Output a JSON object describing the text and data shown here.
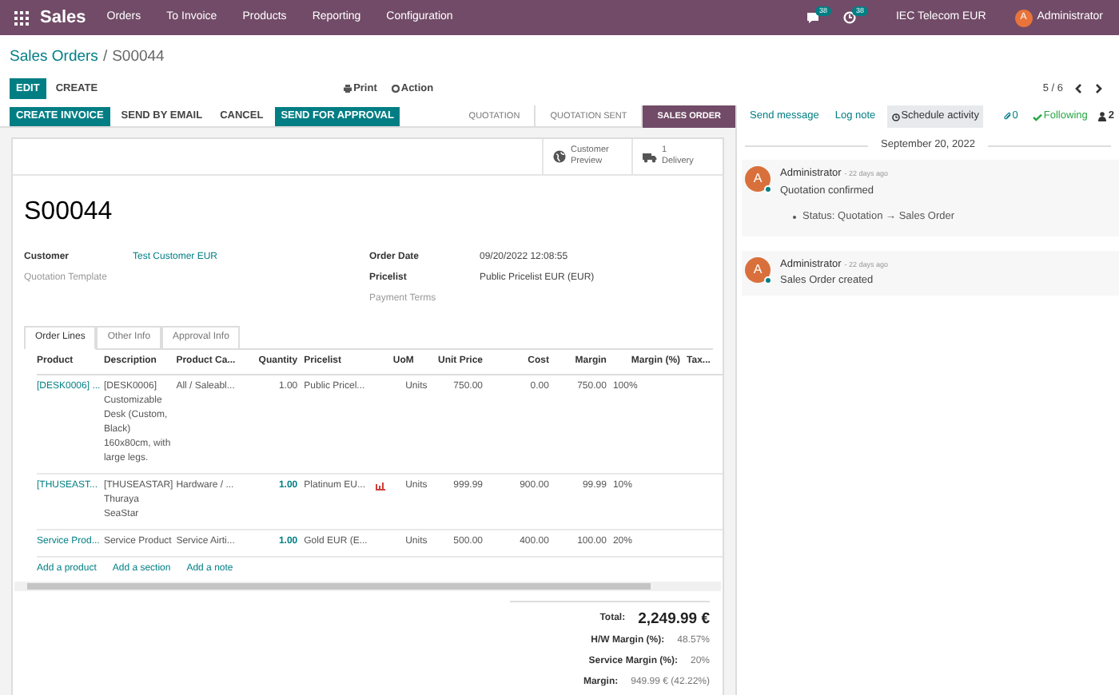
{
  "navbar": {
    "app": "Sales",
    "menus": [
      "Orders",
      "To Invoice",
      "Products",
      "Reporting",
      "Configuration"
    ],
    "messages_badge": "38",
    "activities_badge": "38",
    "company": "IEC Telecom EUR",
    "user": "Administrator",
    "user_initial": "A"
  },
  "breadcrumb": {
    "parent": "Sales Orders",
    "separator": "/",
    "current": "S00044"
  },
  "actions": {
    "edit": "EDIT",
    "create": "CREATE",
    "print": "Print",
    "action": "Action",
    "pager": "5 / 6"
  },
  "header_buttons": [
    {
      "label": "CREATE INVOICE",
      "primary": true
    },
    {
      "label": "SEND BY EMAIL",
      "primary": false
    },
    {
      "label": "CANCEL",
      "primary": false
    },
    {
      "label": "SEND FOR APPROVAL",
      "primary": true
    }
  ],
  "stages": [
    {
      "label": "QUOTATION",
      "selected": false
    },
    {
      "label": "QUOTATION SENT",
      "selected": false
    },
    {
      "label": "SALES ORDER",
      "selected": true
    }
  ],
  "smart_buttons": [
    {
      "kind": "globe",
      "lines": [
        "Customer",
        "Preview"
      ]
    },
    {
      "kind": "truck",
      "lines": [
        "1",
        "Delivery"
      ]
    }
  ],
  "title": "S00044",
  "fields_left": [
    {
      "label": "Customer",
      "value": "Test Customer EUR",
      "strong": true
    },
    {
      "label": "Quotation Template",
      "strong": false
    }
  ],
  "fields_right": [
    {
      "label": "Order Date",
      "value": "09/20/2022 12:08:55",
      "strong": true
    },
    {
      "label": "Pricelist",
      "value": "Public Pricelist EUR (EUR)",
      "strong": true
    },
    {
      "label": "Payment Terms",
      "strong": false
    }
  ],
  "tabs": [
    {
      "label": "Order Lines",
      "selected": true
    },
    {
      "label": "Other Info",
      "selected": false
    },
    {
      "label": "Approval Info",
      "selected": false
    }
  ],
  "table": {
    "columns": [
      "Product",
      "Description",
      "Product Ca...",
      "Quantity",
      "Pricelist",
      "UoM",
      "Unit Price",
      "Cost",
      "Margin",
      "Margin (%)",
      "Tax..."
    ],
    "rows": [
      {
        "cells": [
          "[DESK0006] ...",
          "[DESK0006] Customizable Desk (Custom, Black) 160x80cm, with large legs.",
          "All / Saleabl...",
          "1.00",
          "Public Pricel...",
          "Units",
          "750.00",
          "0.00",
          "750.00",
          "100%"
        ],
        "quantity_emphasis": false,
        "alert": false
      },
      {
        "cells": [
          "[THUSEAST...",
          "[THUSEASTAR] Thuraya SeaStar",
          "Hardware / ...",
          "1.00",
          "Platinum EU...",
          "Units",
          "999.99",
          "900.00",
          "99.99",
          "10%"
        ],
        "quantity_emphasis": true,
        "alert": true
      },
      {
        "cells": [
          "Service Prod...",
          "Service Product",
          "Service Airti...",
          "1.00",
          "Gold EUR (E...",
          "Units",
          "500.00",
          "400.00",
          "100.00",
          "20%"
        ],
        "quantity_emphasis": true,
        "alert": false
      }
    ],
    "add_links": [
      "Add a product",
      "Add a section",
      "Add a note"
    ]
  },
  "totals": [
    {
      "label": "Total:",
      "value": "2,249.99 €",
      "kind": "grand"
    },
    {
      "label": "H/W Margin (%):",
      "value": "48.57%",
      "kind": "line"
    },
    {
      "label": "Service Margin (%):",
      "value": "20%",
      "kind": "line"
    },
    {
      "label": "Margin:",
      "value": "949.99 € (42.22%)",
      "kind": "line"
    }
  ],
  "chatter": {
    "buttons": [
      {
        "label": "Send message",
        "selected": false
      },
      {
        "label": "Log note",
        "selected": false
      },
      {
        "label": "Schedule activity",
        "selected": true
      }
    ],
    "attachments": "0",
    "following": "Following",
    "followers": "2",
    "date": "September 20, 2022",
    "messages": [
      {
        "author": "Administrator",
        "initial": "A",
        "time": "- 22 days ago",
        "body": "Quotation confirmed",
        "tracking": "Status: Quotation → Sales Order"
      },
      {
        "author": "Administrator",
        "initial": "A",
        "time": "- 22 days ago",
        "body": "Sales Order created"
      }
    ]
  }
}
